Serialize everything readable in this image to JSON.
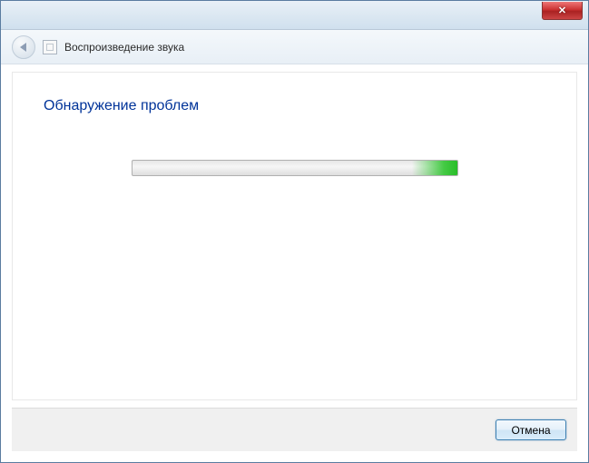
{
  "header": {
    "wizard_title": "Воспроизведение звука"
  },
  "content": {
    "heading": "Обнаружение проблем"
  },
  "footer": {
    "cancel_label": "Отмена"
  }
}
